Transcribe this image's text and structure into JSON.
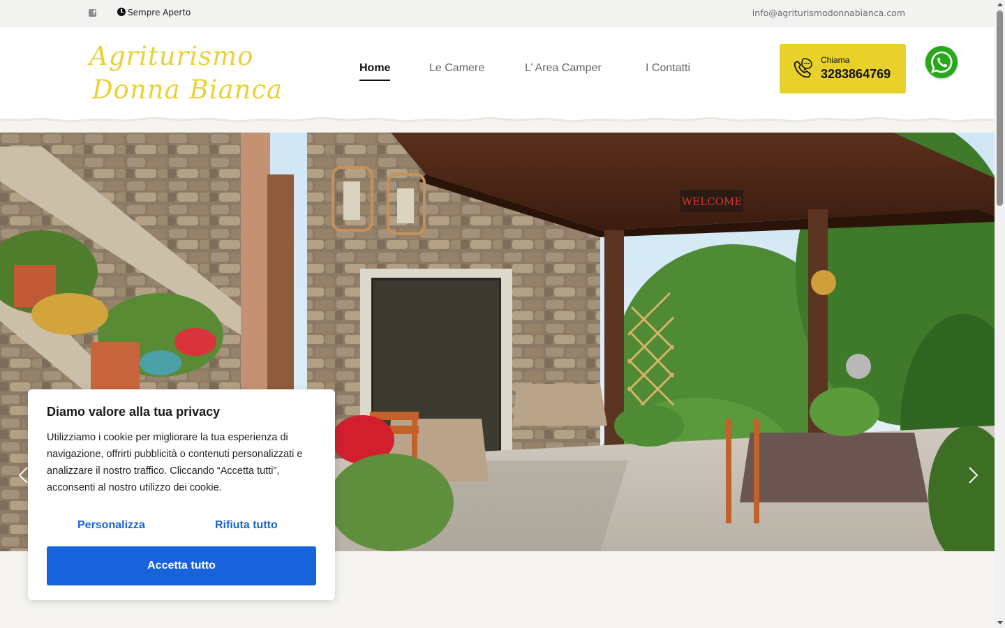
{
  "topbar": {
    "facebook_icon": "facebook-icon",
    "clock_icon": "clock-icon",
    "hours_text": "Sempre Aperto",
    "email": "info@agriturismodonnabianca.com"
  },
  "header": {
    "logo_line1": "Agriturismo",
    "logo_line2": "Donna Bianca",
    "nav": [
      {
        "label": "Home",
        "active": true
      },
      {
        "label": "Le Camere",
        "active": false
      },
      {
        "label": "L’ Area Camper",
        "active": false
      },
      {
        "label": "I Contatti",
        "active": false
      }
    ],
    "call": {
      "label": "Chiama",
      "number": "3283864769",
      "icon": "phone-icon"
    },
    "whatsapp_icon": "whatsapp-icon"
  },
  "hero": {
    "sign_text": "WELCOME",
    "prev_icon": "chevron-left-icon",
    "next_icon": "chevron-right-icon"
  },
  "cookie": {
    "title": "Diamo valore alla tua privacy",
    "text": "Utilizziamo i cookie per migliorare la tua esperienza di navigazione, offrirti pubblicità o contenuti personalizzati e analizzare il nostro traffico. Cliccando “Accetta tutti”, acconsenti al nostro utilizzo dei cookie.",
    "customize_label": "Personalizza",
    "reject_label": "Rifiuta tutto",
    "accept_label": "Accetta tutto"
  },
  "colors": {
    "accent_yellow": "#e7d12a",
    "logo_yellow": "#ead136",
    "cookie_blue": "#1863dc",
    "whatsapp_green": "#29a71a"
  }
}
